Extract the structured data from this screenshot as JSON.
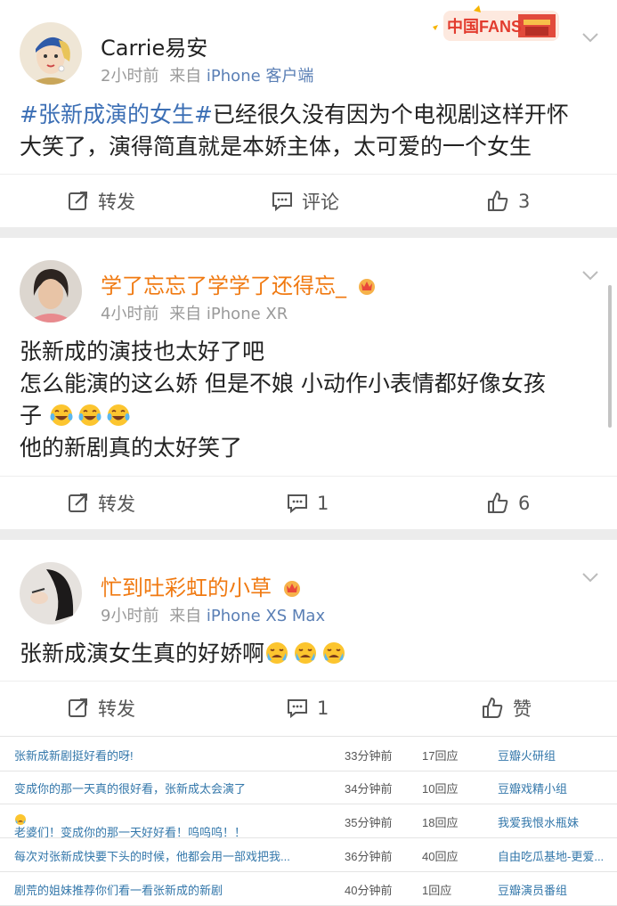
{
  "posts": [
    {
      "user": "Carrie易安",
      "time": "2小时前",
      "from": "来自",
      "device": "iPhone 客户端",
      "hashtag": "#张新成演的女生#",
      "text": "已经很久没有因为个电视剧这样开怀大笑了，演得简直就是本娇主体，太可爱的一个女生",
      "repost_label": "转发",
      "comment_label": "评论",
      "like_label": "3",
      "badge_text": "中国FANS"
    },
    {
      "user": "学了忘忘了学学了还得忘_",
      "time": "4小时前",
      "from": "来自",
      "device": "iPhone XR",
      "lines": [
        "张新成的演技也太好了吧",
        "怎么能演的这么娇 但是不娘 小动作小表情都好像女孩",
        "子",
        "他的新剧真的太好笑了"
      ],
      "repost_label": "转发",
      "comment_label": "1",
      "like_label": "6"
    },
    {
      "user": "忙到吐彩虹的小草",
      "time": "9小时前",
      "from": "来自",
      "device": "iPhone XS Max",
      "text": "张新成演女生真的好娇啊",
      "repost_label": "转发",
      "comment_label": "1",
      "like_label": "赞"
    }
  ],
  "forum": [
    {
      "title": "张新成新剧挺好看的呀!",
      "time": "33分钟前",
      "replies": "17回应",
      "group": "豆瓣火研组"
    },
    {
      "title": "变成你的那一天真的很好看，张新成太会演了",
      "time": "34分钟前",
      "replies": "10回应",
      "group": "豆瓣戏精小组"
    },
    {
      "title": "老婆们！变成你的那一天好好看！呜呜呜！！",
      "time": "35分钟前",
      "replies": "18回应",
      "group": "我爱我恨水瓶妹"
    },
    {
      "title": "每次对张新成快要下头的时候，他都会用一部戏把我...",
      "time": "36分钟前",
      "replies": "40回应",
      "group": "自由吃瓜基地-更爱..."
    },
    {
      "title": "剧荒的姐妹推荐你们看一看张新成的新剧",
      "time": "40分钟前",
      "replies": "1回应",
      "group": "豆瓣演员番组"
    }
  ],
  "colors": {
    "link": "#3c6fb5",
    "vip_name": "#f07a12",
    "gap": "#ececec"
  }
}
